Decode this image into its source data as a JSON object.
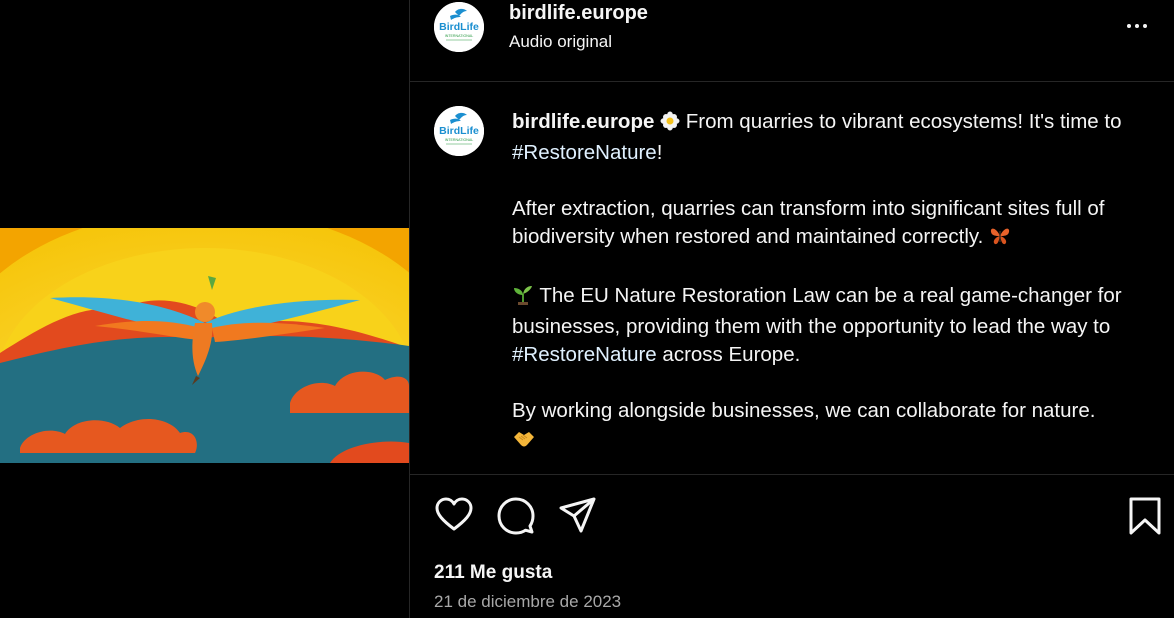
{
  "post": {
    "username": "birdlife.europe",
    "audio": "Audio original",
    "avatar_text": "BirdLife",
    "avatar_sub": "INTERNATIONAL"
  },
  "caption": {
    "username": "birdlife.europe",
    "p1_text": " From quarries to vibrant ecosystems! It's time to ",
    "hashtag1": "#RestoreNature",
    "p1_end": "!",
    "p2": "After extraction, quarries can transform into significant sites full of biodiversity when restored and maintained correctly. ",
    "p3_text": " The EU Nature Restoration Law can be a real game-changer for businesses, providing them with the opportunity to lead the way to ",
    "hashtag2": "#RestoreNature",
    "p3_end": " across Europe.",
    "p4": "By working alongside businesses, we can collaborate for nature.",
    "emojis": [
      "flower-emoji",
      "butterfly-emoji",
      "seedling-emoji",
      "handshake-emoji"
    ]
  },
  "stats": {
    "likes": "211 Me gusta",
    "date": "21 de diciembre de 2023"
  },
  "icons": [
    "more-options-icon",
    "heart-icon",
    "comment-icon",
    "share-icon",
    "bookmark-icon"
  ],
  "colors": {
    "background": "#000000",
    "text": "#f5f5f5",
    "hashtag": "#e0f1ff",
    "muted": "#a8a8a8",
    "divider": "#262626"
  }
}
